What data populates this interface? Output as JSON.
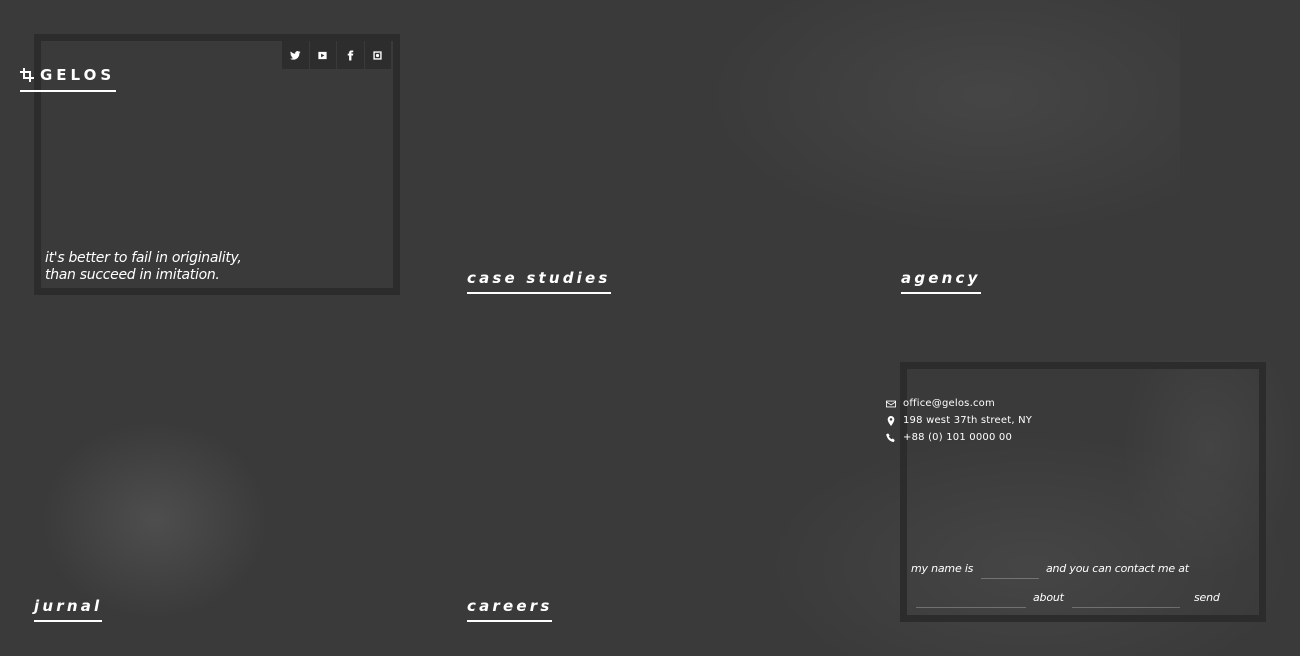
{
  "brand": {
    "name": "GELOS",
    "icon": "crop-icon"
  },
  "social": [
    {
      "name": "twitter",
      "icon": "twitter-icon"
    },
    {
      "name": "youtube",
      "icon": "youtube-icon"
    },
    {
      "name": "facebook",
      "icon": "facebook-icon"
    },
    {
      "name": "instagram",
      "icon": "instagram-icon"
    }
  ],
  "hero": {
    "tagline_line1": "it's better to fail in originality,",
    "tagline_line2": "than succeed in imitation."
  },
  "nav": {
    "case_studies": "case studies",
    "agency": "agency",
    "jurnal": "jurnal",
    "careers": "careers"
  },
  "contact": {
    "email": "office@gelos.com",
    "address": "198  west 37th street, NY",
    "phone": "+88 (0) 101 0000 00"
  },
  "form": {
    "label_name": "my name is",
    "label_contact": "and you can contact me at",
    "label_about": "about",
    "send_label": "send",
    "name_value": "",
    "contact_value": "",
    "about_value": ""
  },
  "colors": {
    "background": "#3a3a3a",
    "frame": "#2c2c2c",
    "text": "#ffffff"
  }
}
